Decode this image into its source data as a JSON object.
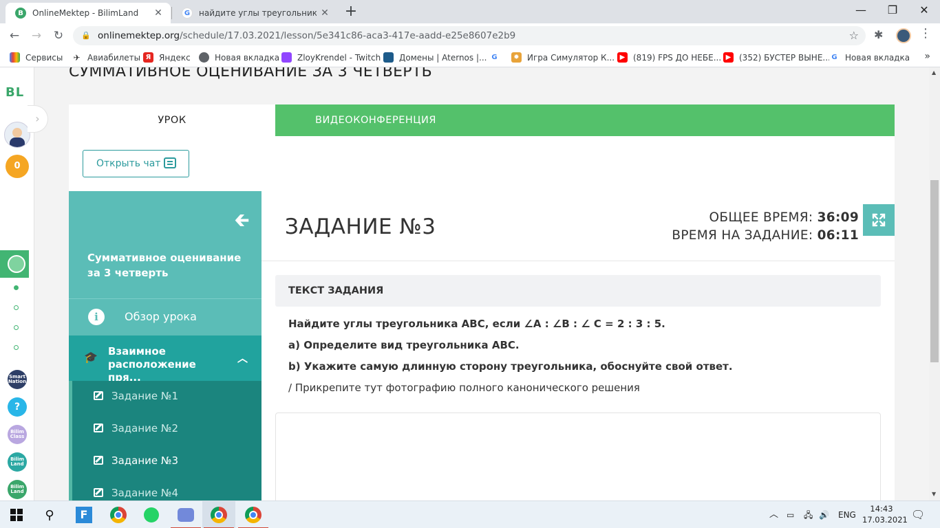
{
  "browser": {
    "tabs": [
      {
        "title": "OnlineMektep - BilimLand",
        "favicon": "bilimland-icon",
        "color": "#3aa66a"
      },
      {
        "title": "найдите углы треугольника abc",
        "favicon": "google-icon"
      }
    ],
    "url_host": "onlinemektep.org",
    "url_path": "/schedule/17.03.2021/lesson/5e341c86-aca3-417e-aadd-e25e8607e2b9",
    "bookmarks": [
      {
        "label": "Сервисы",
        "icon": "apps-grid-icon"
      },
      {
        "label": "Авиабилеты",
        "icon": "plane-icon"
      },
      {
        "label": "Яндекс",
        "icon": "yandex-icon"
      },
      {
        "label": "Новая вкладка",
        "icon": "globe-icon"
      },
      {
        "label": "ZloyKrendel - Twitch",
        "icon": "twitch-icon"
      },
      {
        "label": "Домены | Aternos |...",
        "icon": "aternos-icon"
      },
      {
        "label": "",
        "icon": "google-icon"
      },
      {
        "label": "Игра Симулятор К...",
        "icon": "game-icon"
      },
      {
        "label": "(819) FPS ДО НЕБЕ...",
        "icon": "youtube-icon"
      },
      {
        "label": "(352) БУСТЕР ВЫНЕ...",
        "icon": "youtube-icon"
      },
      {
        "label": "Новая вкладка",
        "icon": "google-icon"
      }
    ]
  },
  "rail": {
    "logo": "BL",
    "coins": "0",
    "apps": [
      "Smart Nation",
      "?",
      "Bilim Class",
      "Bilim Land",
      "Bilim Land"
    ]
  },
  "page": {
    "heading": "СУММАТИВНОЕ ОЦЕНИВАНИЕ ЗА 3 ЧЕТВЕРТЬ",
    "tab_lesson": "УРОК",
    "tab_video": "ВИДЕОКОНФЕРЕНЦИЯ",
    "chat_button": "Открыть чат"
  },
  "sidebar": {
    "title": "Суммативное оценивание за 3 четверть",
    "overview": "Обзор урока",
    "section": "Взаимное расположение пря...",
    "items": [
      "Задание №1",
      "Задание №2",
      "Задание №3",
      "Задание №4"
    ],
    "active_item": "Задание №3"
  },
  "task": {
    "title": "ЗАДАНИЕ №3",
    "total_time_label": "ОБЩЕЕ ВРЕМЯ:",
    "total_time": "36:09",
    "task_time_label": "ВРЕМЯ НА ЗАДАНИЕ:",
    "task_time": "06:11",
    "text_header": "ТЕКСТ ЗАДАНИЯ",
    "line1": "Найдите углы треугольника АВС, если ∠А : ∠В : ∠ С = 2 : 3 : 5.",
    "line2": "а) Определите вид треугольника АВС.",
    "line3": "b) Укажите самую длинную сторону треугольника, обоснуйте свой ответ.",
    "line4": "/ Прикрепите тут фотографию полного канонического решения"
  },
  "taskbar": {
    "lang": "ENG",
    "time": "14:43",
    "date": "17.03.2021"
  },
  "colors": {
    "brand_green": "#54c16b",
    "teal": "#5bbdb7",
    "teal_dark": "#21a39e",
    "teal_list": "#1b857e"
  }
}
